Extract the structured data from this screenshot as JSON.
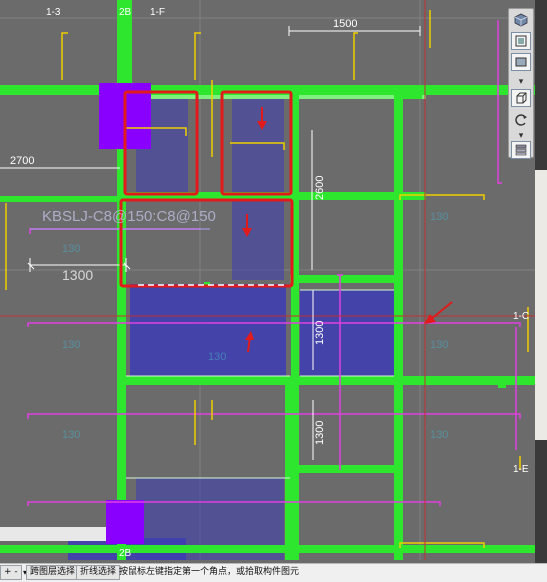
{
  "drawing": {
    "axis_labels": {
      "top_1_3": "1-3",
      "top_2b": "2B",
      "top_1_f": "1-F",
      "bottom_2b": "2B",
      "right_1_c": "1-C",
      "right_1_e": "1-E"
    },
    "dimensions": {
      "top_1500": "1500",
      "left_2700": "2700",
      "vertical_2600": "2600",
      "bottom_1300": "1300",
      "vertical_1300_a": "1300",
      "vertical_1300_b": "1300"
    },
    "rebar_label": "KBSLJ-C8@150:C8@150",
    "faint_labels": {
      "l1": "130",
      "l2": "130",
      "l3": "130",
      "l4": "130",
      "l5": "130",
      "l6": "130",
      "l7": "130"
    }
  },
  "toolbar": {
    "icons": [
      "view-cube-icon",
      "front-view-icon",
      "top-view-icon",
      "box-view-icon",
      "rotate-icon",
      "layers-icon"
    ]
  },
  "statusbar": {
    "dropdown_value": "+ -",
    "layer_select": "跨图层选择",
    "polyline_select": "折线选择",
    "hint": "按鼠标左键指定第一个角点，或拾取构件图元"
  },
  "colors": {
    "background": "#6b6b6b",
    "beam_green": "#2ee62e",
    "slab_blue": "#3c3cb4",
    "wall_purple": "#8a00ff",
    "highlight_red": "#e11b1b",
    "rebar_magenta": "#e040e0",
    "rebar_yellow": "#f0d000",
    "axis_red": "#c03030"
  }
}
